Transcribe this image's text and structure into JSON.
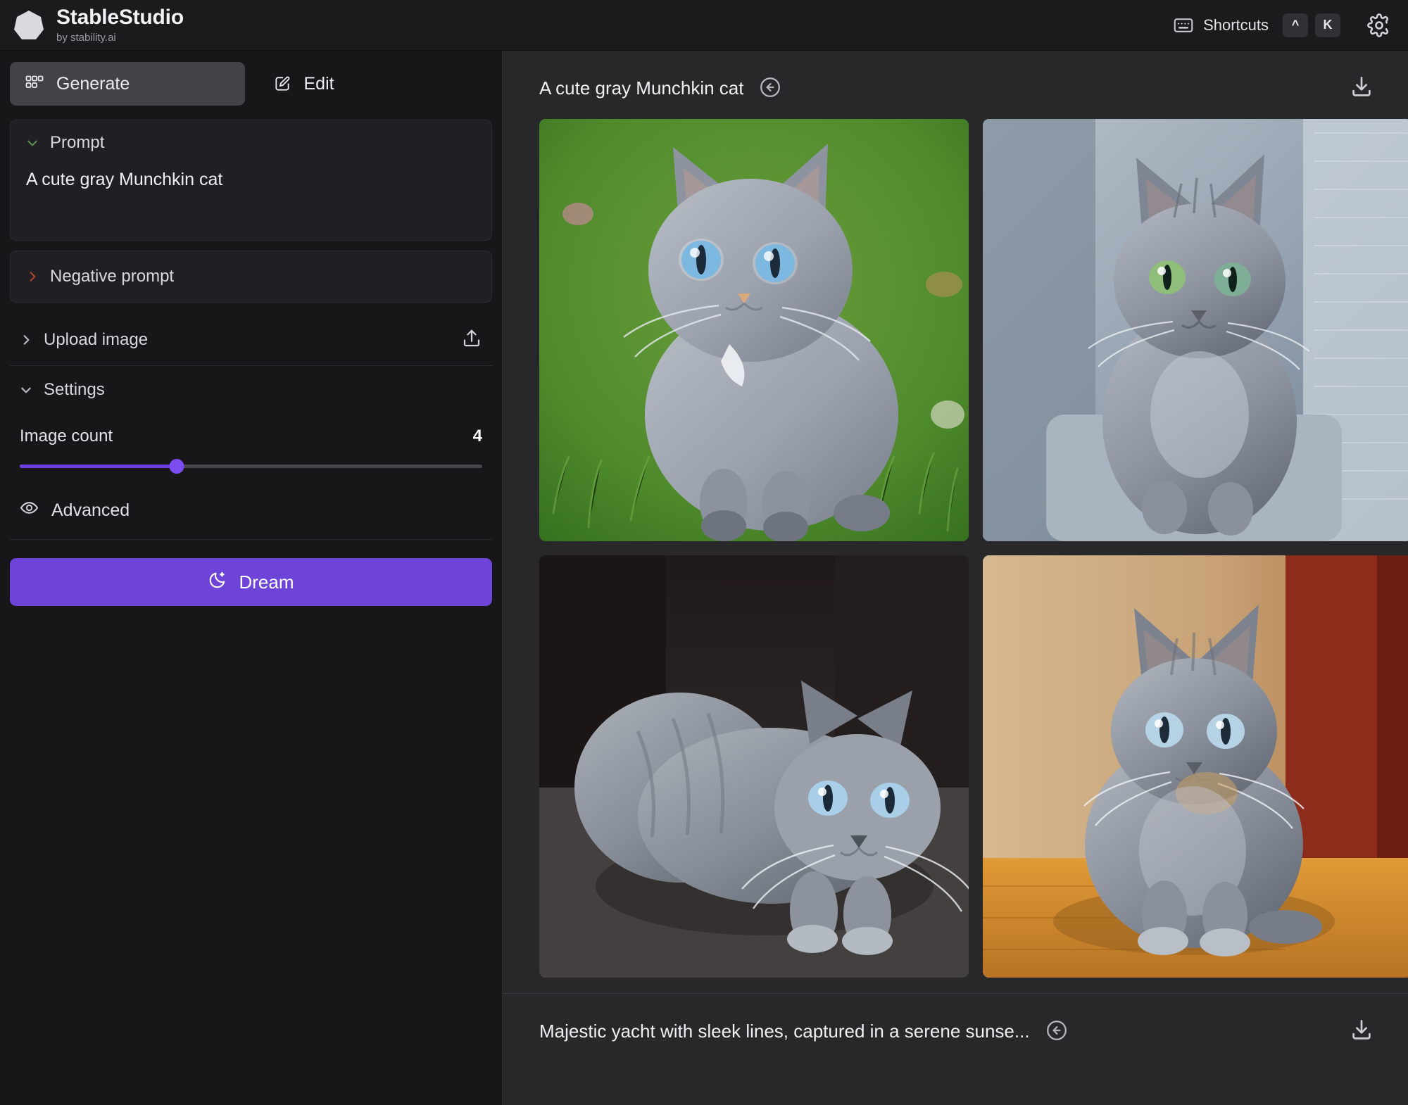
{
  "app": {
    "brand_title": "StableStudio",
    "brand_subtitle": "by stability.ai",
    "logo_icon": "heptagon-logo-icon"
  },
  "topbar": {
    "keyboard_icon": "keyboard-icon",
    "shortcuts_label": "Shortcuts",
    "keycaps": [
      "^",
      "K"
    ],
    "settings_icon": "gear-icon"
  },
  "tabs": [
    {
      "label": "Generate",
      "icon": "grid-squares-icon",
      "active": true
    },
    {
      "label": "Edit",
      "icon": "pencil-square-icon",
      "active": false
    }
  ],
  "sidebar": {
    "prompt": {
      "title": "Prompt",
      "value": "A cute gray Munchkin cat",
      "chevron": "chevron-down-icon",
      "chevron_color": "#5b8a4a",
      "expanded": true
    },
    "negative_prompt": {
      "title": "Negative prompt",
      "chevron": "chevron-right-icon",
      "chevron_color": "#a8442c",
      "expanded": false
    },
    "upload_image": {
      "title": "Upload image",
      "chevron": "chevron-right-icon",
      "action_icon": "upload-icon",
      "expanded": false
    },
    "settings": {
      "title": "Settings",
      "chevron": "chevron-down-icon",
      "expanded": true,
      "image_count": {
        "label": "Image count",
        "value": "4",
        "min": 1,
        "max": 10,
        "percent": 34,
        "accent": "#6d3fe0"
      }
    },
    "advanced": {
      "label": "Advanced",
      "icon": "eye-icon"
    },
    "dream_button": {
      "label": "Dream",
      "icon": "moon-stars-icon",
      "color": "#6d43d8"
    }
  },
  "main": {
    "results": [
      {
        "title": "A cute gray Munchkin cat",
        "back_icon": "circle-arrow-left-icon",
        "download_icon": "download-icon",
        "images": [
          {
            "alt": "gray munchkin kitten with blue eyes sitting on green grass"
          },
          {
            "alt": "gray munchkin kitten sitting on a gray textured couch"
          },
          {
            "alt": "gray munchkin cat crouching on a dark floor"
          },
          {
            "alt": "gray munchkin cat sitting on a wooden floor by a red wall"
          }
        ]
      },
      {
        "title": "Majestic yacht with sleek lines, captured in a serene sunse...",
        "back_icon": "circle-arrow-left-icon",
        "download_icon": "download-icon",
        "images": []
      }
    ]
  },
  "colors": {
    "sidebar_bg": "#17171a",
    "main_bg": "#28282b",
    "topbar_bg": "#1b1b1e",
    "card_bg": "#202024",
    "active_tab_bg": "#424349",
    "accent": "#6d43d8",
    "text": "#f0f0f3"
  }
}
